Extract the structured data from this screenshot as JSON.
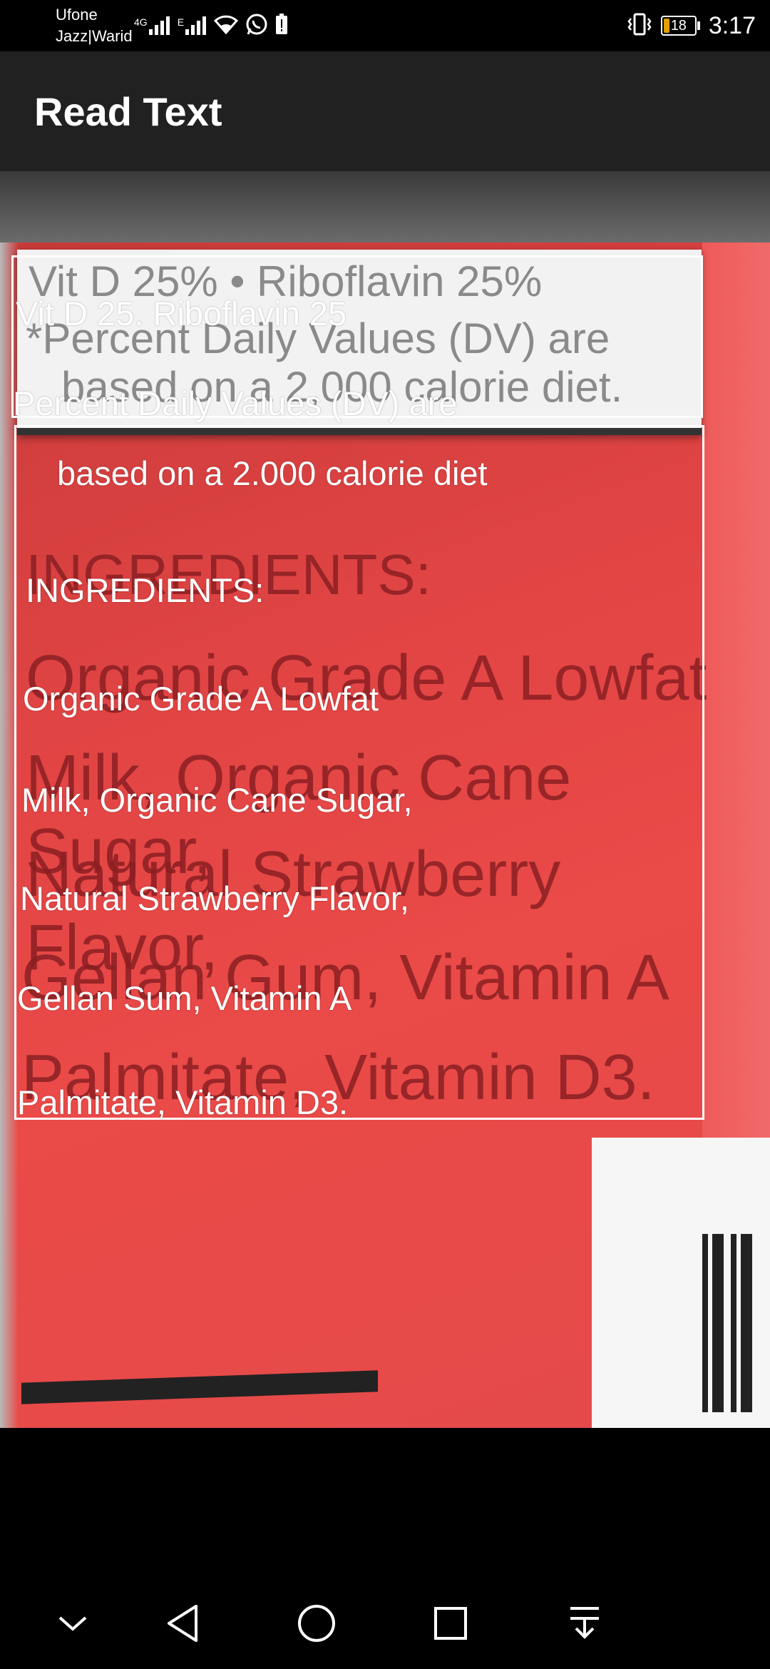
{
  "status_bar": {
    "carrier_line1": "Ufone",
    "carrier_line2": "Jazz|Warid",
    "net_4g": "4G",
    "net_e": "E",
    "battery_level": "18",
    "time": "3:17"
  },
  "app_bar": {
    "title": "Read Text"
  },
  "photo_text": {
    "label_line1": "Vit D 25% • Riboflavin 25%",
    "label_line2": "*Percent Daily Values (DV) are",
    "label_line3": "based on a 2,000 calorie diet.",
    "ing_heading": "INGREDIENTS:",
    "ing_line1": "Organic Grade A Lowfat",
    "ing_line2": "Milk, Organic Cane Sugar,",
    "ing_line3": "Natural Strawberry Flavor,",
    "ing_line4": "Gellan Gum, Vitamin A",
    "ing_line5": "Palmitate, Vitamin D3."
  },
  "ocr_results": {
    "block1": {
      "line1": "Vit D 25. Riboflavin 25",
      "line2": "Percent Daily Values (DV) are"
    },
    "block2": {
      "line1": "based on a 2.000 calorie diet",
      "line2": "INGREDIENTS:",
      "line3": "Organic Grade A Lowfat",
      "line4": "Milk, Organic Cane Sugar,",
      "line5": "Natural Strawberry Flavor,",
      "line6": "Gellan Sum, Vitamin A",
      "line7": "Palmitate, Vitamin D3."
    }
  },
  "nav_bar": {
    "icons": [
      "chevron-down-icon",
      "back-icon",
      "home-icon",
      "recents-icon",
      "notification-pull-icon"
    ]
  },
  "colors": {
    "app_bar": "#212121",
    "label_red": "#e44646",
    "ocr_text": "#ffffff"
  }
}
